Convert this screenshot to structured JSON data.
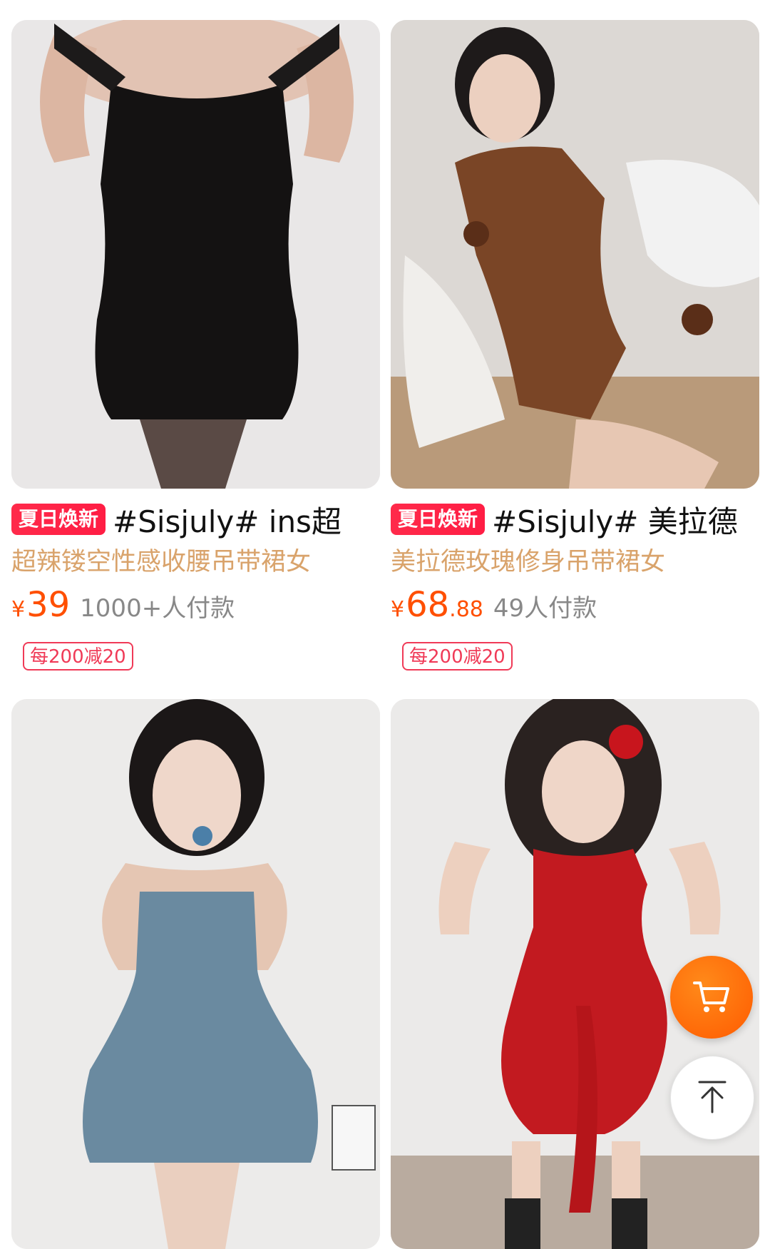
{
  "products": [
    {
      "promo_tag": "夏日焕新",
      "title": "#Sisjuly# ins超",
      "subtitle": "超辣镂空性感收腰吊带裙女",
      "currency": "¥",
      "price_int": "39",
      "price_dec": "",
      "sales": "1000+人付款",
      "coupon": "每200减20",
      "image": "black velvet mini dress"
    },
    {
      "promo_tag": "夏日焕新",
      "title": "#Sisjuly# 美拉德",
      "subtitle": "美拉德玫瑰修身吊带裙女",
      "currency": "¥",
      "price_int": "68",
      "price_dec": ".88",
      "sales": "49人付款",
      "coupon": "每200减20",
      "image": "brown leather dress with roses"
    },
    {
      "image": "denim strapless mini dress"
    },
    {
      "image": "red ruffle halter dress"
    }
  ],
  "floating_buttons": {
    "cart_icon": "cart-icon",
    "back_to_top_icon": "arrow-up-icon"
  },
  "colors": {
    "price": "#ff4f00",
    "promo_tag": "#ff2a4a",
    "subtitle": "#d9a36b",
    "coupon": "#f03a57",
    "cart_fab": "#ff6a00"
  }
}
